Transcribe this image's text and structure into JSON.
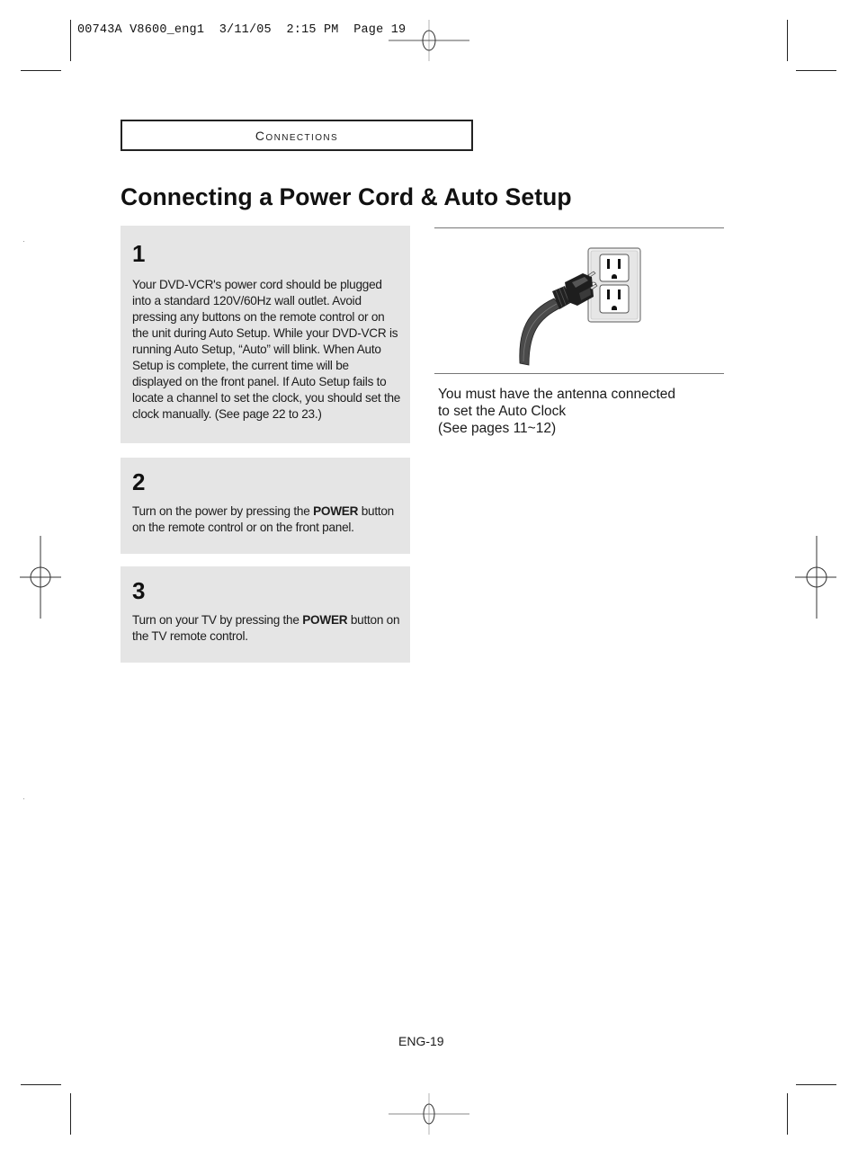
{
  "slug": {
    "job_id": "00743A",
    "file": "V8600_eng1",
    "date": "3/11/05",
    "time": "2:15 PM",
    "page_label": "Page 19"
  },
  "section": {
    "label": "Connections"
  },
  "title": "Connecting a Power Cord & Auto Setup",
  "steps": [
    {
      "number": "1",
      "text_before": "Your DVD-VCR's power cord should be plugged into a standard 120V/60Hz wall outlet. Avoid pressing any buttons on the remote control or on the unit during Auto Setup. While your DVD-VCR is running Auto Setup, “Auto” will blink. When Auto Setup is complete, the current time will be displayed on the front panel. If Auto Setup fails to locate a channel to set the clock, you should set the clock manually. (See page 22 to 23.)",
      "bold": "",
      "text_after": ""
    },
    {
      "number": "2",
      "text_before": "Turn on the power by pressing the ",
      "bold": "POWER",
      "text_after": " button on the remote control or on the front panel."
    },
    {
      "number": "3",
      "text_before": "Turn on your TV by pressing the ",
      "bold": "POWER",
      "text_after": " button on the TV remote control."
    }
  ],
  "illustration": {
    "icon": "power-plug-wall-outlet-icon",
    "colors": {
      "cord": "#4a4a4a",
      "plug": "#1e1e1e",
      "outlet_plate": "#f2f2f2",
      "outlet_border": "#777777"
    }
  },
  "note": {
    "lines": [
      "You must have the antenna connected",
      "to set the Auto Clock",
      "(See pages 11~12)"
    ]
  },
  "footer": {
    "page_number": "ENG-19"
  },
  "colors": {
    "step_background": "#e5e5e5",
    "text": "#1a1a1a",
    "rule": "#777777"
  }
}
